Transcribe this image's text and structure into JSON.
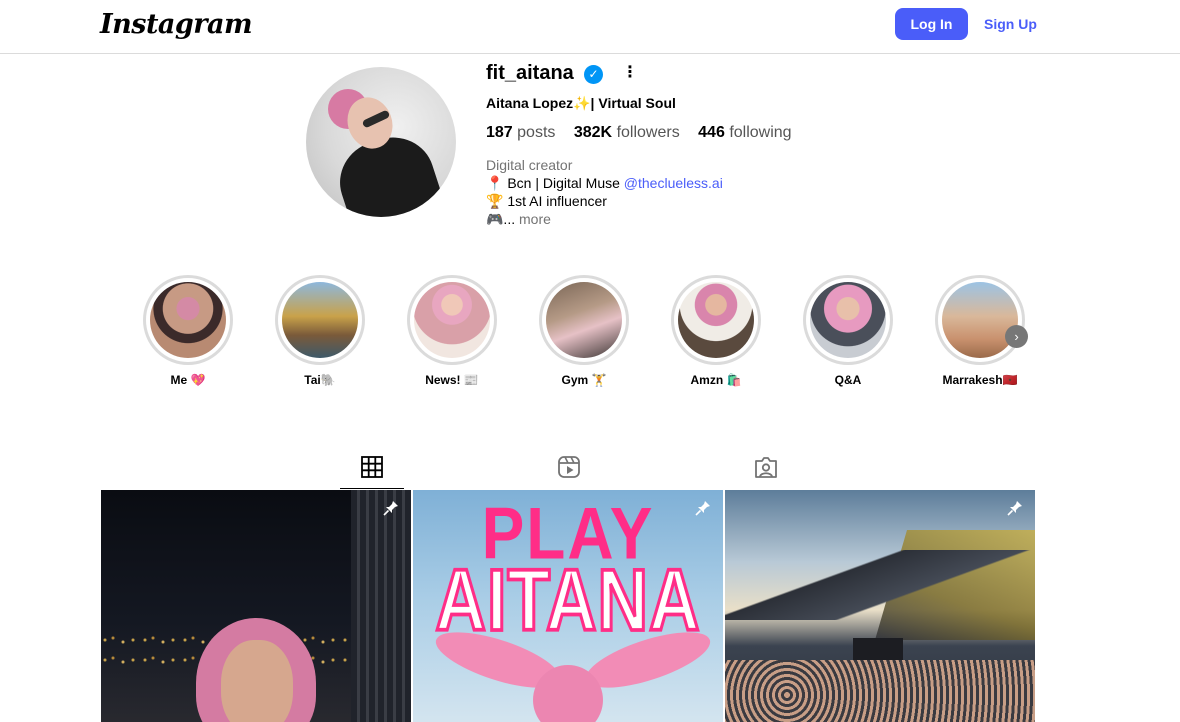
{
  "header": {
    "logo_text": "Instagram",
    "login_label": "Log In",
    "signup_label": "Sign Up",
    "accent_color": "#4a5df9"
  },
  "profile": {
    "username": "fit_aitana",
    "verified_icon": "verified-badge-icon",
    "full_name": "Aitana Lopez✨| Virtual Soul",
    "stats": {
      "posts_count": "187",
      "posts_label": "posts",
      "followers_count": "382K",
      "followers_label": "followers",
      "following_count": "446",
      "following_label": "following"
    },
    "bio": {
      "category": "Digital creator",
      "line1_prefix": "📍 Bcn | Digital Muse ",
      "line1_mention": "@theclueless.ai",
      "line2": "🏆 1st AI influencer",
      "line3": "🎮...",
      "more_label": "more"
    }
  },
  "highlights": [
    {
      "label": "Me 💖"
    },
    {
      "label": "Tai🐘"
    },
    {
      "label": "News! 📰"
    },
    {
      "label": "Gym 🏋"
    },
    {
      "label": "Amzn 🛍️"
    },
    {
      "label": "Q&A"
    },
    {
      "label": "Marrakesh🇲🇦"
    }
  ],
  "tabs": [
    {
      "icon": "grid-icon",
      "active": true
    },
    {
      "icon": "reels-icon",
      "active": false
    },
    {
      "icon": "tagged-icon",
      "active": false
    }
  ],
  "posts": [
    {
      "pinned": true,
      "overlay_text": []
    },
    {
      "pinned": true,
      "overlay_text": [
        "PLAY",
        "AITANA"
      ]
    },
    {
      "pinned": true,
      "overlay_text": []
    }
  ],
  "post_text": {
    "line1": "PLAY",
    "line2": "AITANA"
  }
}
